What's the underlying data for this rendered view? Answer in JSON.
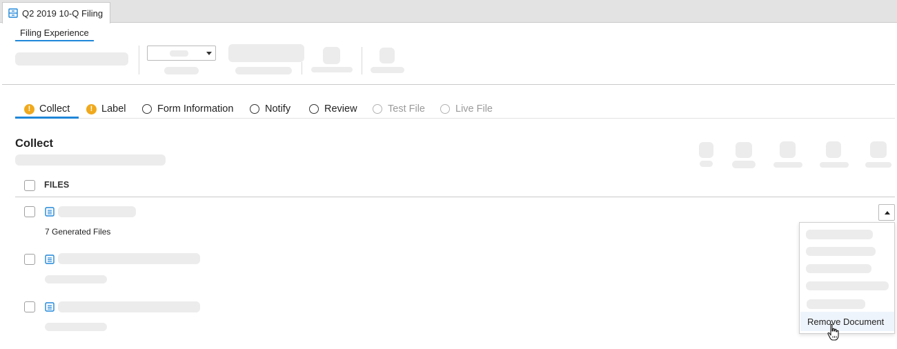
{
  "tabbar": {
    "doc_tab_label": "Q2 2019 10-Q Filing",
    "doc_tab_icon": "filing-cabinet-icon"
  },
  "subnav": {
    "active_label": "Filing Experience"
  },
  "toolbar": {
    "dropdown_icon": "chevron-down-icon"
  },
  "steps": {
    "items": [
      {
        "label": "Collect",
        "state": "warning",
        "active": true
      },
      {
        "label": "Label",
        "state": "warning",
        "active": false
      },
      {
        "label": "Form Information",
        "state": "pending",
        "active": false
      },
      {
        "label": "Notify",
        "state": "pending",
        "active": false
      },
      {
        "label": "Review",
        "state": "pending",
        "active": false
      },
      {
        "label": "Test File",
        "state": "disabled",
        "active": false
      },
      {
        "label": "Live File",
        "state": "disabled",
        "active": false
      }
    ],
    "warn_glyph": "!"
  },
  "section": {
    "title": "Collect"
  },
  "files": {
    "header": "FILES",
    "first_row_caption": "7 Generated Files",
    "row_icon": "document-icon"
  },
  "context_menu": {
    "remove_label": "Remove Document",
    "trigger_icon": "caret-up-icon",
    "cursor_icon": "hand-pointer-icon"
  },
  "colors": {
    "accent": "#1f86d8",
    "warning": "#f0a91c",
    "placeholder": "#ececec",
    "disabled_text": "#9a9a9a"
  }
}
